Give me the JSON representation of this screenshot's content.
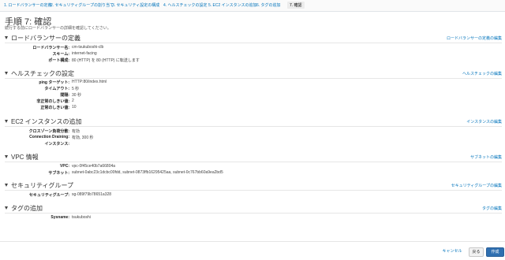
{
  "steps": [
    "1. ロードバランサーの定義",
    "2. セキュリティグループの割り当て",
    "3. セキュリティ設定の構成",
    "4. ヘルスチェックの設定",
    "5. EC2 インスタンスの追加",
    "6. タグの追加",
    "7. 確認"
  ],
  "page": {
    "title": "手順 7: 確認",
    "subtitle": "続行する前にロードバランサーの詳細を確認してください。"
  },
  "sections": {
    "lb": {
      "title": "ロードバランサーの定義",
      "edit": "ロードバランサーの定義の編集",
      "rows": [
        {
          "label": "ロードバランサー名:",
          "value": "cm-tsukuboshi-clb"
        },
        {
          "label": "スキーム:",
          "value": "internet-facing"
        },
        {
          "label": "ポート構成:",
          "value": "80 (HTTP) を 80 (HTTP) に転送します"
        }
      ]
    },
    "health": {
      "title": "ヘルスチェックの設定",
      "edit": "ヘルスチェックの編集",
      "rows": [
        {
          "label": "ping ターゲット:",
          "value": "HTTP:80/index.html"
        },
        {
          "label": "タイムアウト:",
          "value": "5 秒"
        },
        {
          "label": "間隔:",
          "value": "30 秒"
        },
        {
          "label": "非正常のしきい値:",
          "value": "2"
        },
        {
          "label": "正常のしきい値:",
          "value": "10"
        }
      ]
    },
    "ec2": {
      "title": "EC2 インスタンスの追加",
      "edit": "インスタンスの編集",
      "rows": [
        {
          "label": "クロスゾーン負荷分散:",
          "value": "有効"
        },
        {
          "label": "Connection Draining:",
          "value": "有効, 300 秒"
        },
        {
          "label": "インスタンス:",
          "value": ""
        }
      ]
    },
    "vpc": {
      "title": "VPC 情報",
      "edit": "サブネットの編集",
      "rows": [
        {
          "label": "VPC:",
          "value": "vpc-0f45ce40b7a66804a"
        },
        {
          "label": "サブネット:",
          "value": "subnet-0abc23c1dcbc00fdd, subnet-0873ffb16295425aa, subnet-0c767bb60a9ea2bd5"
        }
      ]
    },
    "sg": {
      "title": "セキュリティグループ",
      "edit": "セキュリティグループの編集",
      "rows": [
        {
          "label": "セキュリティグループ:",
          "value": "sg-089f79b78651a328"
        }
      ]
    },
    "tags": {
      "title": "タグの追加",
      "edit": "タグの編集",
      "rows": [
        {
          "label": "Sysname:",
          "value": "tsukuboshi"
        }
      ]
    }
  },
  "buttons": {
    "cancel": "キャンセル",
    "back": "戻る",
    "create": "作成"
  }
}
